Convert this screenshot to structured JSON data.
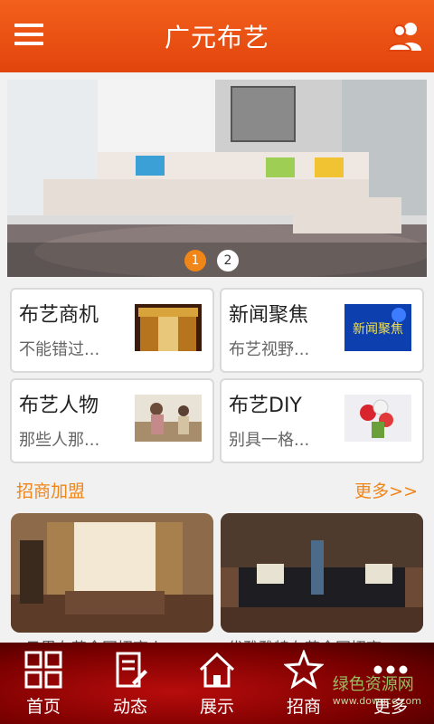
{
  "header": {
    "title": "广元布艺"
  },
  "banner": {
    "pages": [
      "1",
      "2"
    ],
    "active": "1"
  },
  "cards": [
    {
      "title": "布艺商机",
      "subtitle": "不能错过..."
    },
    {
      "title": "新闻聚焦",
      "subtitle": "布艺视野...",
      "thumb_text": "新闻聚焦"
    },
    {
      "title": "布艺人物",
      "subtitle": "那些人那..."
    },
    {
      "title": "布艺DIY",
      "subtitle": "别具一格..."
    }
  ],
  "section": {
    "title": "招商加盟",
    "more": "更多>>"
  },
  "products": [
    {
      "caption": "日里布艺全国招商火"
    },
    {
      "caption": "优雅雅特布艺全国招商"
    }
  ],
  "bottom_nav": [
    {
      "label": "首页",
      "icon": "grid-icon"
    },
    {
      "label": "动态",
      "icon": "document-edit-icon"
    },
    {
      "label": "展示",
      "icon": "home-icon"
    },
    {
      "label": "招商",
      "icon": "star-icon"
    },
    {
      "label": "更多",
      "icon": "more-dots-icon"
    }
  ],
  "watermark": {
    "text": "绿色资源网",
    "url": "www.downcc.com"
  },
  "colors": {
    "header": "#e2440c",
    "accent": "#f08518",
    "nav": "#7a0000"
  }
}
